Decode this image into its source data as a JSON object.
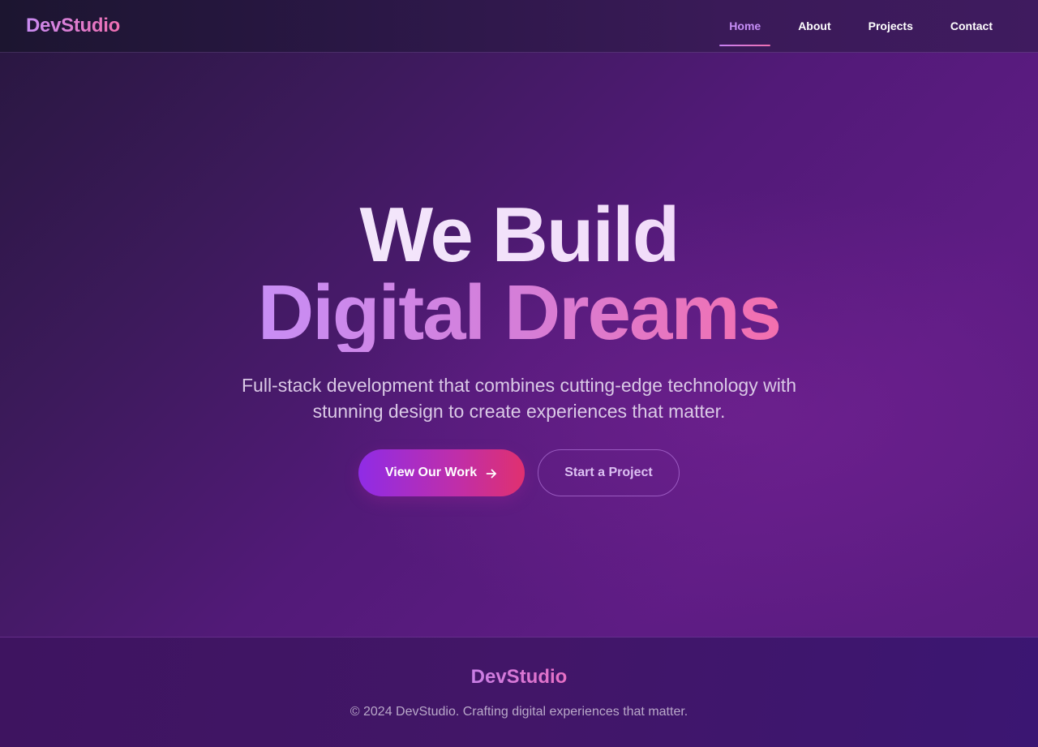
{
  "brand": {
    "name": "DevStudio"
  },
  "nav": {
    "items": [
      {
        "label": "Home",
        "active": true
      },
      {
        "label": "About",
        "active": false
      },
      {
        "label": "Projects",
        "active": false
      },
      {
        "label": "Contact",
        "active": false
      }
    ]
  },
  "hero": {
    "title_line1": "We Build",
    "title_line2": "Digital Dreams",
    "subtitle": "Full-stack development that combines cutting-edge technology with stunning design to create experiences that matter.",
    "primary_button": {
      "label": "View Our Work",
      "icon": "arrow-right-icon"
    },
    "secondary_button": {
      "label": "Start a Project"
    }
  },
  "footer": {
    "brand": "DevStudio",
    "copyright": "© 2024 DevStudio. Crafting digital experiences that matter."
  },
  "colors": {
    "accent_purple": "#c68ef6",
    "accent_pink": "#f06fb1",
    "hero_bg": "#521a78",
    "primary_button_start": "#8f2ce6",
    "primary_button_end": "#e0306f"
  }
}
